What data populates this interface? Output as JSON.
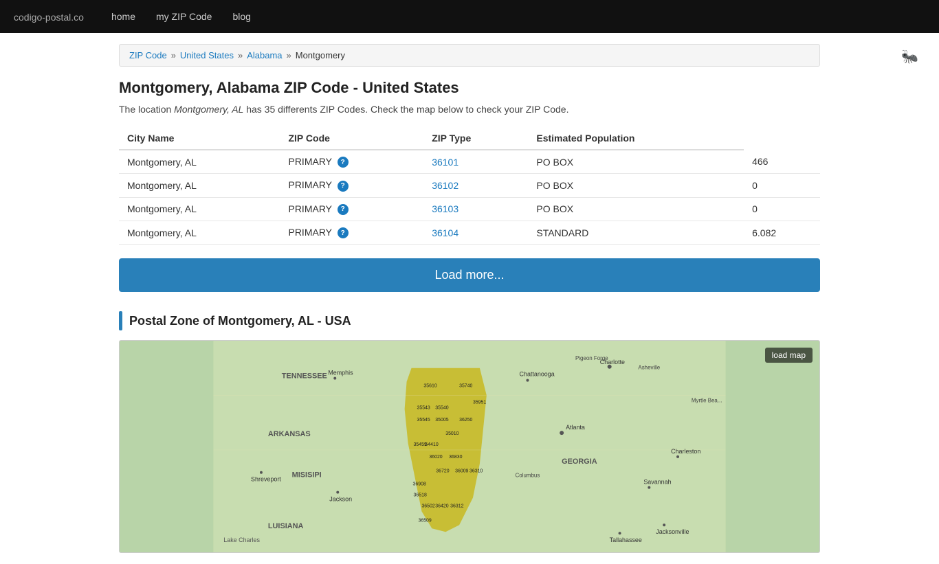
{
  "navbar": {
    "brand": "codigo-postal",
    "brand_suffix": ".co",
    "links": [
      {
        "label": "home",
        "href": "#"
      },
      {
        "label": "my ZIP Code",
        "href": "#"
      },
      {
        "label": "blog",
        "href": "#"
      }
    ]
  },
  "breadcrumb": {
    "items": [
      {
        "label": "ZIP Code",
        "href": "#"
      },
      {
        "label": "United States",
        "href": "#"
      },
      {
        "label": "Alabama",
        "href": "#"
      },
      {
        "label": "Montgomery",
        "href": null
      }
    ]
  },
  "page": {
    "title": "Montgomery, Alabama ZIP Code - United States",
    "description_prefix": "The location ",
    "description_location": "Montgomery, AL",
    "description_suffix": " has 35 differents ZIP Codes. Check the map below to check your ZIP Code."
  },
  "table": {
    "columns": [
      "City Name",
      "ZIP Code",
      "ZIP Type",
      "Estimated Population"
    ],
    "rows": [
      {
        "city": "Montgomery, AL",
        "city_type": "PRIMARY",
        "zip": "36101",
        "zip_type": "PO BOX",
        "population": "466"
      },
      {
        "city": "Montgomery, AL",
        "city_type": "PRIMARY",
        "zip": "36102",
        "zip_type": "PO BOX",
        "population": "0"
      },
      {
        "city": "Montgomery, AL",
        "city_type": "PRIMARY",
        "zip": "36103",
        "zip_type": "PO BOX",
        "population": "0"
      },
      {
        "city": "Montgomery, AL",
        "city_type": "PRIMARY",
        "zip": "36104",
        "zip_type": "STANDARD",
        "population": "6.082"
      }
    ]
  },
  "load_more_label": "Load more...",
  "map_section": {
    "heading": "Postal Zone of Montgomery, AL - USA",
    "load_map_label": "load map"
  },
  "map_labels": [
    "TENNESSEE",
    "ARKANSAS",
    "MISISIPI",
    "GEORGIA",
    "LUISIANA",
    "Charlotte",
    "Atlanta",
    "Shreveport",
    "Jackson",
    "Tallahassee",
    "Jacksonville",
    "Memphis",
    "Chattanooga",
    "Savannah",
    "Charleston",
    "35610",
    "35740",
    "35951",
    "35543",
    "35540",
    "35545",
    "35005",
    "36250",
    "35010",
    "35459",
    "54410",
    "36020",
    "36830",
    "36720",
    "36009",
    "36310",
    "36908",
    "36518",
    "36502",
    "36420",
    "36312",
    "36509",
    "Pigeon Forge",
    "Asheville",
    "Myrtle Bea...",
    "Lake Charles"
  ],
  "colors": {
    "navbar_bg": "#111111",
    "brand_color": "#ffffff",
    "link_color": "#1a7abf",
    "button_bg": "#2980b9",
    "section_bar": "#2980b9",
    "map_highlight": "#b8a832",
    "map_bg": "#d4e8c2"
  }
}
